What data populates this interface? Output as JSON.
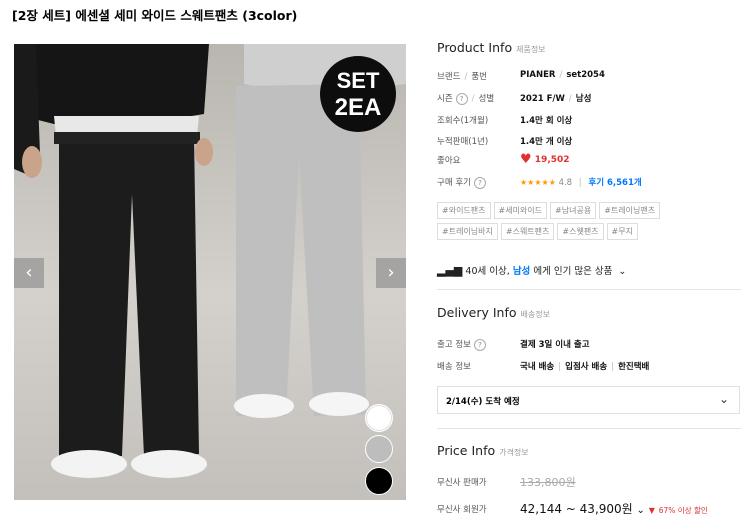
{
  "title": "[2장 세트] 에센셜 세미 와이드 스웨트팬츠 (3color)",
  "image": {
    "badge_line1": "SET",
    "badge_line2": "2EA",
    "prev": "‹",
    "next": "›",
    "swatches": [
      "#ffffff",
      "#bdbdbd",
      "#000000"
    ]
  },
  "product_info": {
    "heading": "Product Info",
    "heading_sub": "제품정보",
    "brand_label": "브랜드",
    "number_label": "품번",
    "brand": "PIANER",
    "number": "set2054",
    "season_label": "시즌",
    "gender_label": "성별",
    "season": "2021 F/W",
    "gender": "남성",
    "views_label": "조회수(1개월)",
    "views": "1.4만 회 이상",
    "sales_label": "누적판매(1년)",
    "sales": "1.4만 개 이상",
    "likes_label": "좋아요",
    "likes": "19,502",
    "review_label": "구매 후기",
    "stars": "★★★★★",
    "rating": "4.8",
    "reviews": "후기 6,561개",
    "tags_row1": [
      "#와이드팬츠",
      "#세미와이드",
      "#남녀공용",
      "#트레이닝팬츠"
    ],
    "tags_row2": [
      "#트레이닝바지",
      "#스웨트팬츠",
      "#스웻팬츠",
      "#무지"
    ],
    "popular_pre": "40세 이상,",
    "popular_gender": "남성",
    "popular_post": "에게 인기 많은 상품"
  },
  "delivery_info": {
    "heading": "Delivery Info",
    "heading_sub": "배송정보",
    "ship_label": "출고 정보",
    "ship_value": "결제 3일 이내 출고",
    "method_label": "배송 정보",
    "method1": "국내 배송",
    "method2": "입점사 배송",
    "method3": "한진택배",
    "arrival": "2/14(수) 도착 예정"
  },
  "price_info": {
    "heading": "Price Info",
    "heading_sub": "가격정보",
    "sale_label": "무신사 판매가",
    "sale_price": "133,800원",
    "member_label": "무신사 회원가",
    "member_price": "42,144 ~ 43,900원",
    "discount": "67% 이상 할인"
  },
  "colors": {
    "accent_blue": "#0078ff",
    "heart_red": "#e03131",
    "discount_red": "#e03131",
    "star": "#ff9900"
  }
}
